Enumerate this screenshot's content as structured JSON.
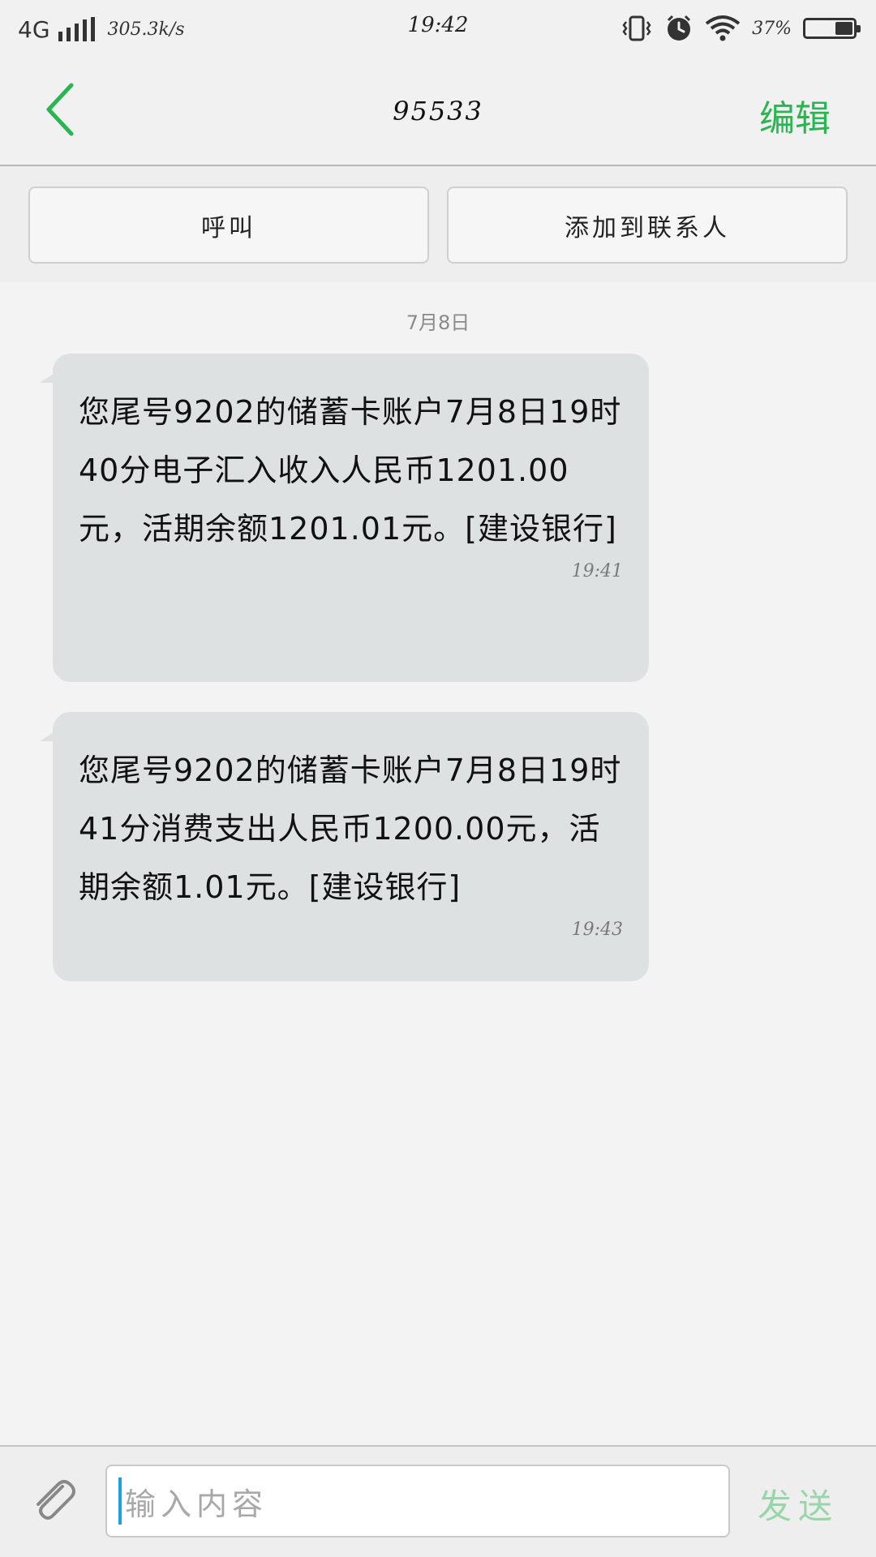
{
  "status_bar": {
    "network": "4G",
    "speed": "305.3k/s",
    "time": "19:42",
    "battery_percent": "37%",
    "battery_level": 0.37,
    "icons": [
      "vibrate-icon",
      "alarm-icon",
      "wifi-icon",
      "battery-icon"
    ]
  },
  "header": {
    "title": "95533",
    "edit_label": "编辑",
    "back_icon": "chevron-left-icon",
    "accent_color": "#2bb551"
  },
  "actions": {
    "call_label": "呼叫",
    "add_contact_label": "添加到联系人"
  },
  "conversation": {
    "date_label": "7月8日",
    "messages": [
      {
        "text": "您尾号9202的储蓄卡账户7月8日19时40分电子汇入收入人民币1201.00元，活期余额1201.01元。[建设银行]",
        "time": "19:41"
      },
      {
        "text": "您尾号9202的储蓄卡账户7月8日19时41分消费支出人民币1200.00元，活期余额1.01元。[建设银行]",
        "time": "19:43"
      }
    ],
    "bubble_color": "#dde1e2"
  },
  "composer": {
    "placeholder": "输入内容",
    "send_label": "发送",
    "attach_icon": "paperclip-icon",
    "send_color": "#98d6a9"
  }
}
